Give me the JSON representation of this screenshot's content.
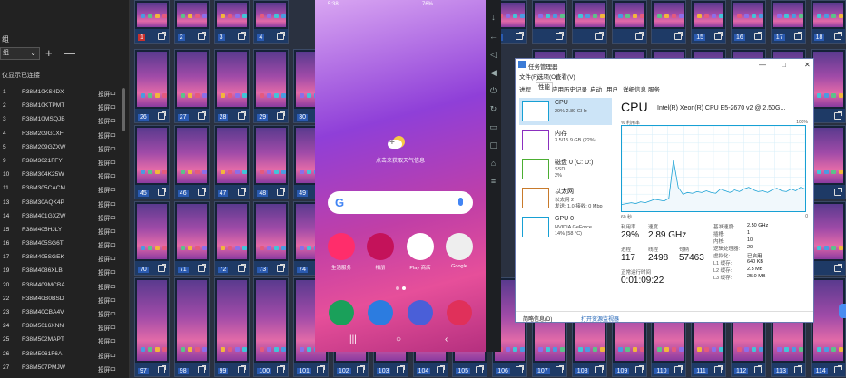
{
  "left_panel": {
    "title": "组",
    "group_select": "组",
    "add_label": "+",
    "remove_label": "—",
    "only_connected_label": "仅显示已连接",
    "devices": [
      {
        "num": "1",
        "serial": "R38M10KS4DX",
        "status": "投屏中"
      },
      {
        "num": "2",
        "serial": "R38M10KTPMT",
        "status": "投屏中"
      },
      {
        "num": "3",
        "serial": "R38M10MSQJB",
        "status": "投屏中"
      },
      {
        "num": "4",
        "serial": "R38M209G1XF",
        "status": "投屏中"
      },
      {
        "num": "5",
        "serial": "R38M209GZXW",
        "status": "投屏中"
      },
      {
        "num": "9",
        "serial": "R38M3021FFY",
        "status": "投屏中"
      },
      {
        "num": "10",
        "serial": "R38M304K25W",
        "status": "投屏中"
      },
      {
        "num": "11",
        "serial": "R38M305CACM",
        "status": "投屏中"
      },
      {
        "num": "13",
        "serial": "R38M30AQK4P",
        "status": "投屏中"
      },
      {
        "num": "14",
        "serial": "R38M401GXZW",
        "status": "投屏中"
      },
      {
        "num": "15",
        "serial": "R38M405HJLY",
        "status": "投屏中"
      },
      {
        "num": "16",
        "serial": "R38M405SG6T",
        "status": "投屏中"
      },
      {
        "num": "17",
        "serial": "R38M405SGEK",
        "status": "投屏中"
      },
      {
        "num": "19",
        "serial": "R38M4086XLB",
        "status": "投屏中"
      },
      {
        "num": "20",
        "serial": "R38M409MCBA",
        "status": "投屏中"
      },
      {
        "num": "22",
        "serial": "R38M40B0BSD",
        "status": "投屏中"
      },
      {
        "num": "23",
        "serial": "R38M40CBA4V",
        "status": "投屏中"
      },
      {
        "num": "24",
        "serial": "R38M5016XNN",
        "status": "投屏中"
      },
      {
        "num": "25",
        "serial": "R38M502MAPT",
        "status": "投屏中"
      },
      {
        "num": "26",
        "serial": "R38M5061F6A",
        "status": "投屏中"
      },
      {
        "num": "27",
        "serial": "R38M507PMJW",
        "status": "投屏中"
      },
      {
        "num": "28",
        "serial": "R38M5083MNI",
        "status": "投屏中"
      }
    ]
  },
  "grid": {
    "row1": [
      "1",
      "2",
      "3",
      "4",
      "5",
      "",
      "",
      "",
      "",
      "15",
      "16",
      "17",
      "18",
      "19",
      "20",
      "21",
      "22",
      "23",
      "24"
    ],
    "row2": [
      "26",
      "27",
      "28",
      "29",
      "30"
    ],
    "row3": [
      "45",
      "46",
      "47",
      "48",
      "49"
    ],
    "row4": [
      "70",
      "71",
      "72",
      "73",
      "74"
    ],
    "row5": [
      "97",
      "98",
      "99",
      "100",
      "101",
      "102",
      "103",
      "104",
      "105",
      "106",
      "107",
      "108",
      "109",
      "110",
      "111",
      "112",
      "113",
      "114",
      "115",
      "116",
      "117",
      "118"
    ]
  },
  "phone": {
    "time": "5:38",
    "battery": "76%",
    "weather_text": "点击来获取天气信息",
    "apps": [
      "生活服务",
      "相册",
      "Play 商店",
      "Google"
    ]
  },
  "taskmgr": {
    "title": "任务管理器",
    "menu": [
      "文件(F)",
      "选项(O)",
      "查看(V)"
    ],
    "tabs": [
      "进程",
      "性能",
      "应用历史记录",
      "启动",
      "用户",
      "详细信息",
      "服务"
    ],
    "sidebar": [
      {
        "name": "CPU",
        "l2": "29%  2.89 GHz",
        "l3": ""
      },
      {
        "name": "内存",
        "l2": "3.5/15.9 GB (22%)",
        "l3": ""
      },
      {
        "name": "磁盘 0 (C: D:)",
        "l2": "SSD",
        "l3": "2%"
      },
      {
        "name": "以太网",
        "l2": "以太网 2",
        "l3": "发送: 1.0 接收: 0 Mbp"
      },
      {
        "name": "GPU 0",
        "l2": "NVIDIA GeForce...",
        "l3": "14% (58 °C)"
      }
    ],
    "cpu_head": "CPU",
    "cpu_model": "Intel(R) Xeon(R) CPU E5-2670 v2 @ 2.50G...",
    "util_label": "% 利用率",
    "util_max": "100%",
    "time_label": "60 秒",
    "zero_label": "0",
    "utilization_label": "利用率",
    "utilization": "29%",
    "speed_label": "速度",
    "speed": "2.89 GHz",
    "process_label": "进程",
    "processes": "117",
    "threads_label": "线程",
    "threads": "2498",
    "handles_label": "句柄",
    "handles": "57463",
    "uptime_label": "正常运行时间",
    "uptime": "0:01:09:22",
    "specs": [
      {
        "k": "基准速度:",
        "v": "2.50 GHz"
      },
      {
        "k": "插槽:",
        "v": "1"
      },
      {
        "k": "内核:",
        "v": "10"
      },
      {
        "k": "逻辑处理器:",
        "v": "20"
      },
      {
        "k": "虚拟化:",
        "v": "已启用"
      },
      {
        "k": "L1 缓存:",
        "v": "640 KB"
      },
      {
        "k": "L2 缓存:",
        "v": "2.5 MB"
      },
      {
        "k": "L3 缓存:",
        "v": "25.0 MB"
      }
    ],
    "footer_less": "简略信息(D)",
    "footer_open": "打开资源监视器",
    "cpu_history": [
      8,
      9,
      10,
      9,
      11,
      10,
      12,
      14,
      13,
      12,
      15,
      60,
      28,
      20,
      22,
      21,
      23,
      22,
      24,
      22,
      21,
      26,
      24,
      22,
      25,
      23,
      26,
      28,
      25,
      23,
      24,
      22,
      25,
      27,
      24,
      23,
      26,
      24,
      28,
      26
    ]
  }
}
